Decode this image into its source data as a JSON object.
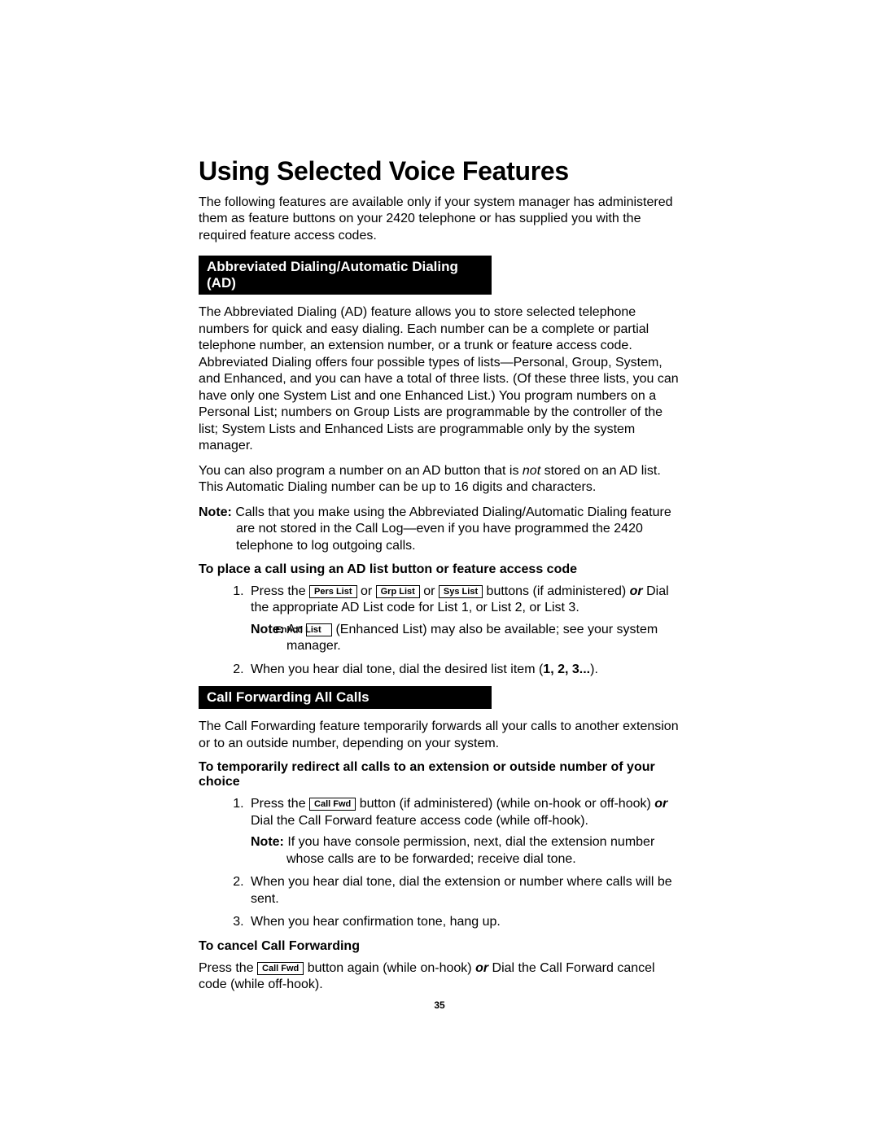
{
  "title": "Using Selected Voice Features",
  "intro": "The following features are available only if your system manager has administered them as feature buttons on your 2420 telephone or has supplied you with the required feature access codes.",
  "section1": {
    "header": "Abbreviated Dialing/Automatic Dialing (AD)",
    "p1": "The Abbreviated Dialing (AD) feature allows you to store selected telephone numbers for quick and easy dialing. Each number can be a complete or partial telephone number, an extension number, or a trunk or feature access code. Abbreviated Dialing offers four possible types of lists—Personal, Group, System, and Enhanced, and you can have a total of three lists. (Of these three lists, you can have only one System List and one Enhanced List.) You program numbers on a Personal List; numbers on Group Lists are programmable by the controller of the list; System Lists and Enhanced Lists are programmable only by the system manager.",
    "p2_a": "You can also program a number on an AD button that is ",
    "p2_not": "not",
    "p2_b": " stored on an AD list. This Automatic Dialing number can be up to 16 digits and characters.",
    "note_label": "Note:",
    "note_text": "Calls that you make using the Abbreviated Dialing/Automatic Dialing feature are not stored in the Call Log—even if you have programmed the 2420 telephone to log outgoing calls.",
    "sub1": "To place a call using an AD list button or feature access code",
    "step1_a": "Press the ",
    "btn_pers": "Pers List",
    "or1": " or ",
    "btn_grp": "Grp List",
    "or2": " or ",
    "btn_sys": "Sys List",
    "step1_b": " buttons (if administered) ",
    "step1_or": "or",
    "step1_c": " Dial the appropriate AD List code for List 1, or List 2, or List 3.",
    "step1_note_a": "An ",
    "btn_enhcd": "Enhcd List",
    "step1_note_b": " (Enhanced List) may also be available; see your system manager.",
    "step2_a": "When you hear dial tone, dial the desired list item (",
    "step2_bold": "1, 2, 3...",
    "step2_b": ")."
  },
  "section2": {
    "header": "Call Forwarding All Calls",
    "p1": "The Call Forwarding feature temporarily forwards all your calls to another extension or to an outside number, depending on your system.",
    "sub1": "To temporarily redirect all calls to an extension or outside number of your choice",
    "step1_a": "Press the ",
    "btn_callfwd": "Call Fwd",
    "step1_b": " button (if administered) (while on-hook or off-hook) ",
    "step1_or": "or",
    "step1_c": " Dial the Call Forward feature access code (while off-hook).",
    "step1_note": "If you have console permission, next, dial the extension number whose calls are to be forwarded; receive dial tone.",
    "step2": "When you hear dial tone, dial the extension or number where calls will be sent.",
    "step3": "When you hear confirmation tone, hang up.",
    "sub2": "To cancel Call Forwarding",
    "cancel_a": "Press the ",
    "cancel_b": " button again (while on-hook) ",
    "cancel_or": "or",
    "cancel_c": " Dial the Call Forward cancel code (while off-hook)."
  },
  "pageNumber": "35"
}
